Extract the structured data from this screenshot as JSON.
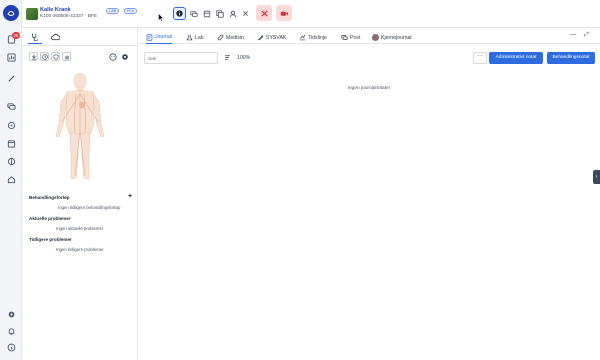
{
  "patient": {
    "name": "Kalle Krank",
    "id_line": "K100 060506-42337 · BFE",
    "tags": [
      "LAB",
      "PLU"
    ]
  },
  "rail": {
    "badge_count": "25",
    "icons": [
      "journal-icon",
      "chart-icon",
      "chat-icon",
      "monitor-icon",
      "calendar-icon",
      "sensor-icon",
      "home-icon",
      "settings-icon",
      "bell-icon",
      "info-icon"
    ]
  },
  "toolbar": {
    "icons": [
      "info-icon",
      "chat-icon",
      "window-icon",
      "pages-icon",
      "person-icon",
      "close-icon"
    ],
    "red_buttons": [
      "disconnect-icon",
      "video-icon"
    ]
  },
  "left_panel": {
    "tabs": [
      "stethoscope-icon",
      "cloud-icon"
    ],
    "tools": [
      "download-icon",
      "clock-icon",
      "shield-icon",
      "hand-icon"
    ],
    "right_tools": [
      "face-icon",
      "gear-icon"
    ],
    "sections": [
      {
        "title": "Behandlingsforløp",
        "empty": "Ingen tidligere behandlingsforløp"
      },
      {
        "title": "Aktuelle problemer",
        "empty": "Ingen aktuelle problemer"
      },
      {
        "title": "Tidligere problemer",
        "empty": "Ingen tidligere problemer"
      }
    ]
  },
  "main": {
    "tabs": [
      {
        "label": "Journal",
        "icon": "journal-icon"
      },
      {
        "label": "Lab",
        "icon": "flask-icon"
      },
      {
        "label": "Medisin",
        "icon": "pill-icon"
      },
      {
        "label": "SYSVAK",
        "icon": "syringe-icon"
      },
      {
        "label": "Tidslinje",
        "icon": "timeline-icon"
      },
      {
        "label": "Post",
        "icon": "chat-icon"
      },
      {
        "label": "Kjernejournal",
        "icon": "kjernejournal-icon"
      }
    ],
    "active_tab": "Journal",
    "search_placeholder": "Søk",
    "zoom": "100%",
    "more_label": "···",
    "buttons": [
      "Administrativt notat",
      "Behandlingsnotat"
    ],
    "empty_message": "Ingen journalnotater",
    "window_controls": {
      "minimize": "—",
      "expand": "⤢"
    }
  },
  "side_handle": "‹"
}
